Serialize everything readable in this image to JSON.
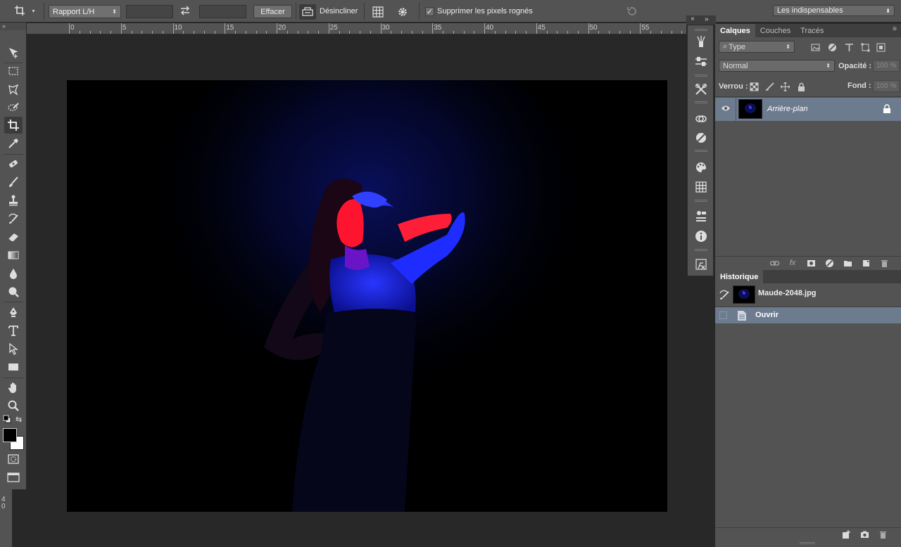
{
  "options_bar": {
    "ratio_select": "Rapport L/H",
    "clear_button": "Effacer",
    "straighten_label": "Désincliner",
    "delete_cropped_label": "Supprimer les pixels rognés",
    "delete_cropped_checked": true,
    "workspace_select": "Les indispensables"
  },
  "ruler": {
    "top_labels": [
      "0",
      "5",
      "10",
      "15",
      "20",
      "25",
      "30",
      "35",
      "40",
      "45",
      "50",
      "55"
    ],
    "left_label": "4 0"
  },
  "layers_panel": {
    "tabs": [
      "Calques",
      "Couches",
      "Tracés"
    ],
    "active_tab": "Calques",
    "filter_select": "Type",
    "blend_mode": "Normal",
    "opacity_label": "Opacité :",
    "opacity_value": "100 %",
    "lock_label": "Verrou :",
    "fill_label": "Fond :",
    "fill_value": "100 %",
    "layers": [
      {
        "name": "Arrière-plan",
        "visible": true,
        "locked": true,
        "selected": true
      }
    ]
  },
  "history_panel": {
    "title": "Historique",
    "snapshot": "Maude-2048.jpg",
    "states": [
      "Ouvrir"
    ]
  },
  "colors": {
    "panel_bg": "#535353",
    "selection": "#6d7b8e",
    "canvas_bg": "#282828"
  }
}
